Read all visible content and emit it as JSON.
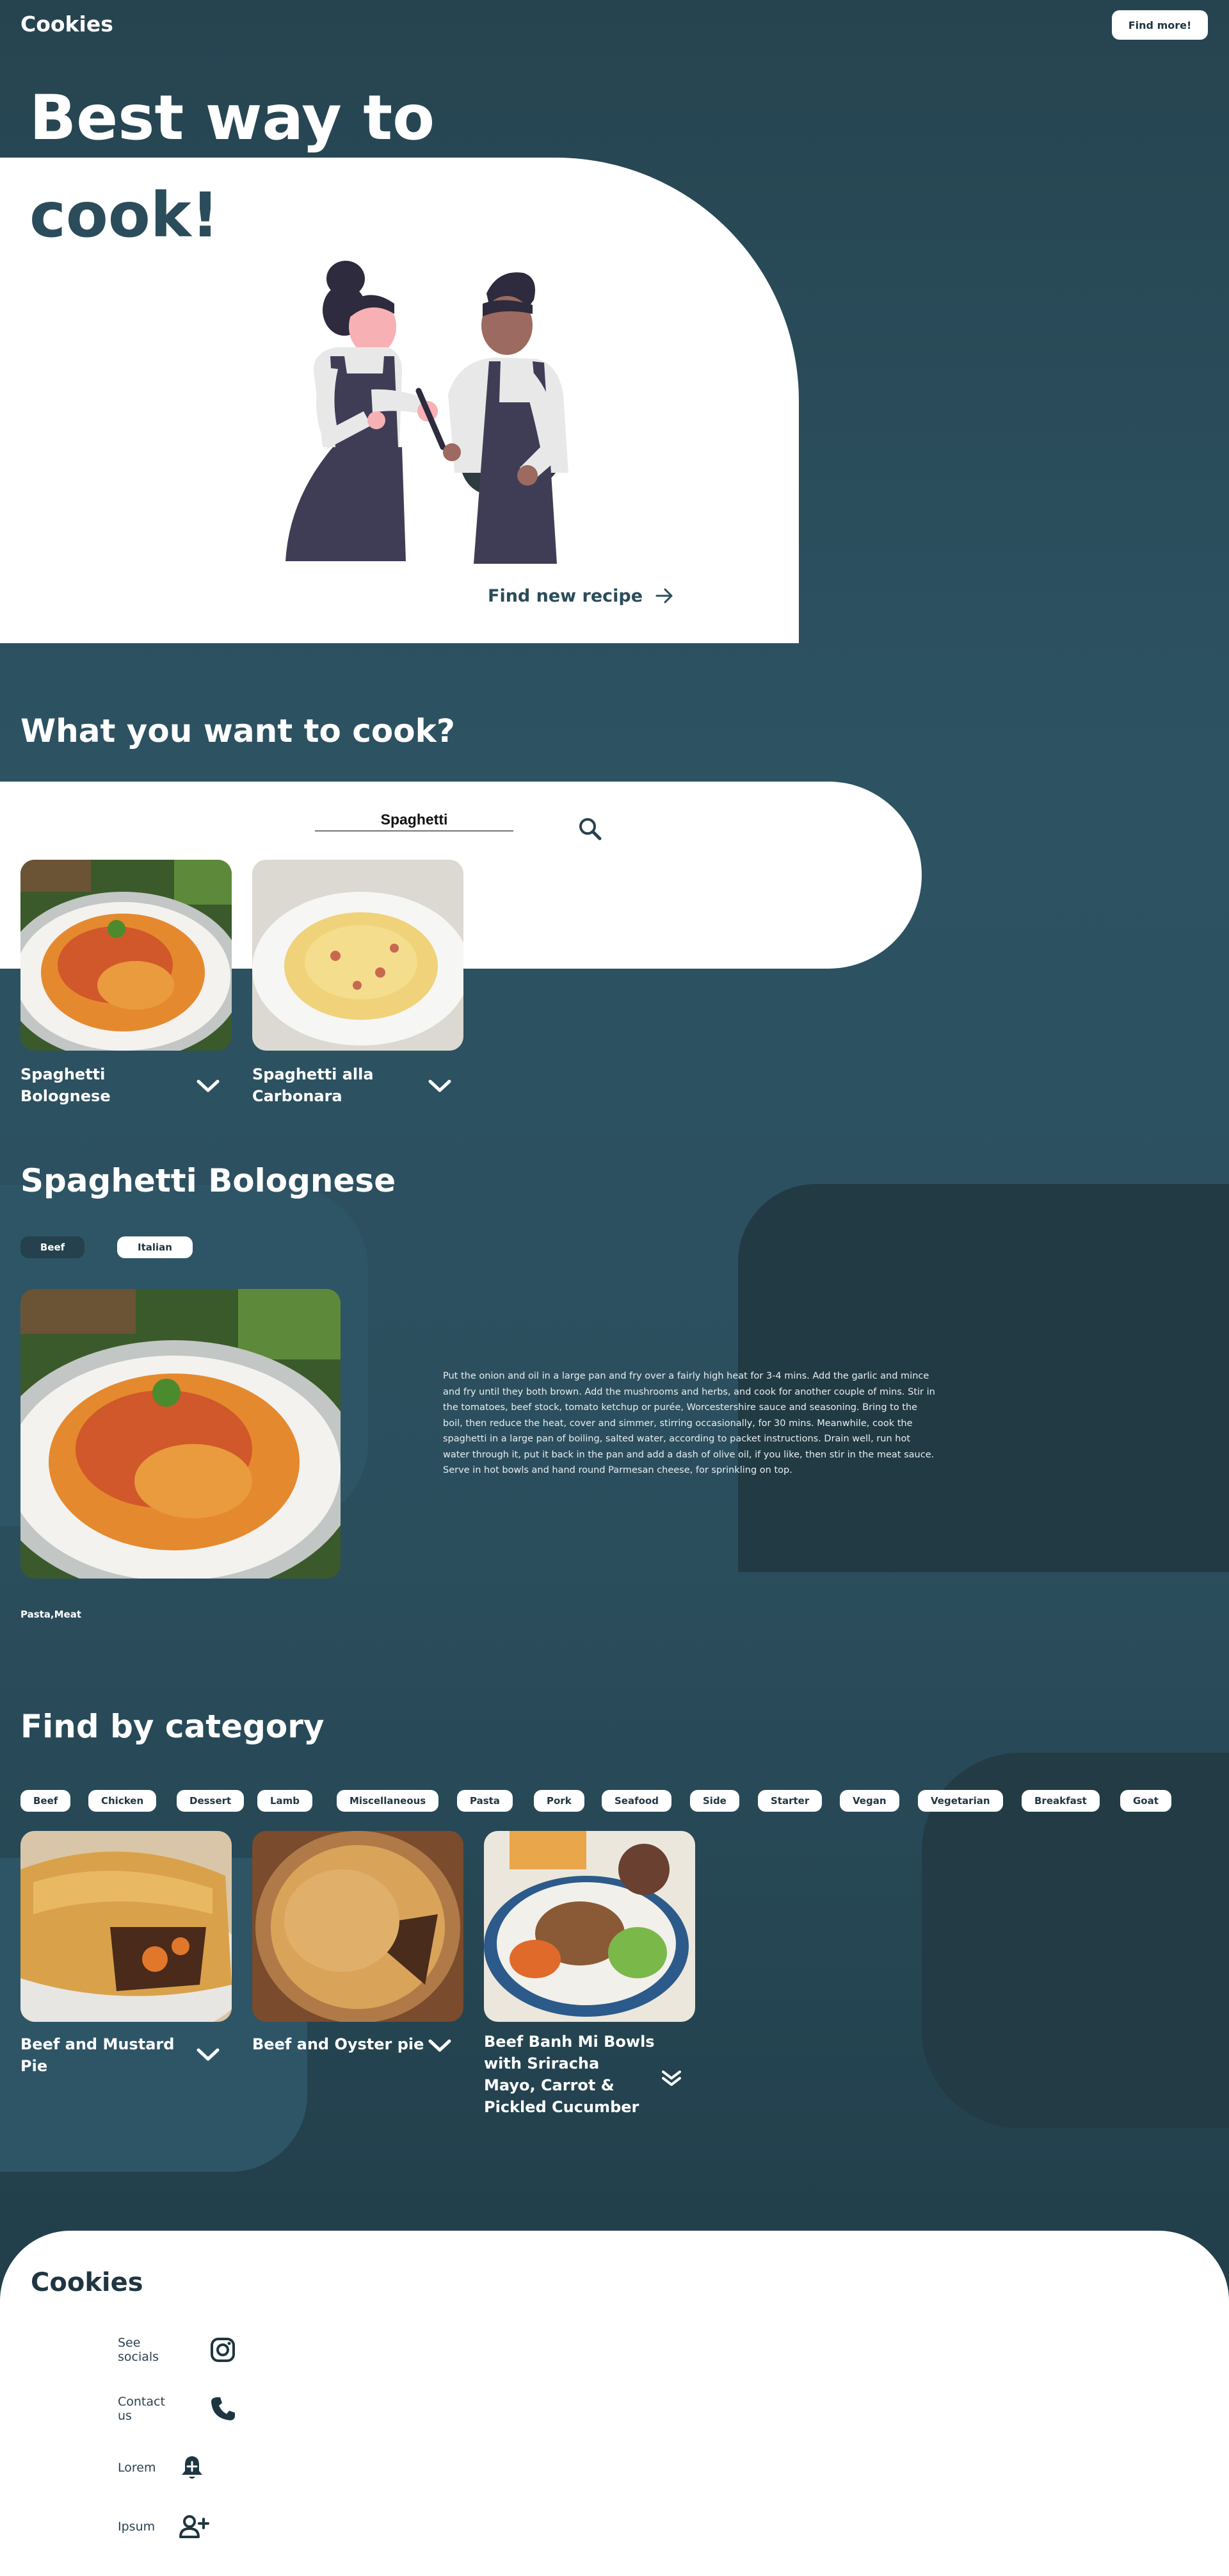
{
  "header": {
    "logo": "Cookies",
    "cta_label": "Find more!"
  },
  "hero": {
    "line1": "Best way to",
    "line2": "cook!",
    "find_new_recipe": "Find new recipe"
  },
  "search_section": {
    "heading": "What you want to cook?",
    "search_value": "Spaghetti",
    "results": [
      {
        "title_line1": "Spaghetti",
        "title_line2": "Bolognese"
      },
      {
        "title_line1": "Spaghetti alla",
        "title_line2": "Carbonara"
      }
    ]
  },
  "detail": {
    "title": "Spaghetti Bolognese",
    "category": "Beef",
    "area": "Italian",
    "instructions": "Put the onion and oil in a large pan and fry over a fairly high heat for 3-4 mins. Add the garlic and mince and fry until they both brown. Add the mushrooms and herbs, and cook for another couple of mins. Stir in the tomatoes, beef stock, tomato ketchup or purée, Worcestershire sauce and seasoning. Bring to the boil, then reduce the heat, cover and simmer, stirring occasionally, for 30 mins. Meanwhile, cook the spaghetti in a large pan of boiling, salted water, according to packet instructions. Drain well, run hot water through it, put it back in the pan and add a dash of olive oil, if you like, then stir in the meat sauce. Serve in hot bowls and hand round Parmesan cheese, for sprinkling on top.",
    "tags": "Pasta,Meat"
  },
  "category_section": {
    "heading": "Find by category",
    "categories": [
      "Beef",
      "Chicken",
      "Dessert",
      "Lamb",
      "Miscellaneous",
      "Pasta",
      "Pork",
      "Seafood",
      "Side",
      "Starter",
      "Vegan",
      "Vegetarian",
      "Breakfast",
      "Goat"
    ],
    "results": [
      {
        "title_line1": "Beef and Mustard",
        "title_line2": "Pie"
      },
      {
        "title_line1": "Beef and Oyster pie",
        "title_line2": ""
      },
      {
        "title_line1": "Beef Banh Mi Bowls",
        "title_line2": "with Sriracha",
        "title_line3": "Mayo, Carrot &",
        "title_line4": "Pickled Cucumber"
      }
    ]
  },
  "footer": {
    "logo": "Cookies",
    "items": [
      {
        "label": "See socials",
        "icon": "instagram-icon"
      },
      {
        "label": "Contact us",
        "icon": "phone-icon"
      },
      {
        "label": "Lorem",
        "icon": "bell-plus-icon"
      },
      {
        "label": "Ipsum",
        "icon": "add-user-icon"
      }
    ]
  },
  "colors": {
    "primary_dark": "#264450",
    "accent_text": "#2b4c5a",
    "white": "#ffffff"
  }
}
